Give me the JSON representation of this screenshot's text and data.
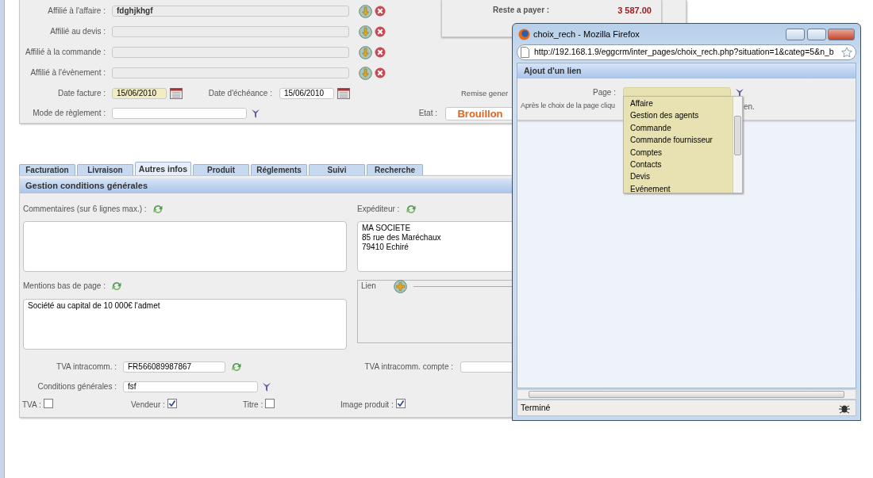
{
  "summary": {
    "label": "Reste a payer :",
    "value": "3 587.00"
  },
  "affiliations": [
    {
      "label": "Affilié à l'affaire :",
      "value": "fdghjkhgf"
    },
    {
      "label": "Affilié au devis :"
    },
    {
      "label": "Affilié à la commande :"
    },
    {
      "label": "Affilié à l'évènement :"
    }
  ],
  "dates": {
    "invoice_label": "Date facture :",
    "invoice_value": "15/06/2010",
    "due_label": "Date d'échéance :",
    "due_value": "15/06/2010",
    "discount_label": "Remise gener"
  },
  "payment": {
    "label": "Mode de règlement :",
    "status_label": "Etat :",
    "status_value": "Brouillon"
  },
  "tabs": [
    {
      "label": "Facturation",
      "selected": false
    },
    {
      "label": "Livraison",
      "selected": false
    },
    {
      "label": "Autres infos",
      "selected": true
    },
    {
      "label": "Produit",
      "selected": false
    },
    {
      "label": "Réglements",
      "selected": false
    },
    {
      "label": "Suivi",
      "selected": false
    },
    {
      "label": "Recherche",
      "selected": false
    }
  ],
  "panel": {
    "title": "Gestion conditions générales",
    "comments_label": "Commentaires (sur 6 lignes max.) :",
    "sender_label": "Expéditeur :",
    "sender_value": "MA SOCIETE\n85 rue des Maréchaux\n79410 Echiré",
    "footer_label": "Mentions bas de page :",
    "footer_value": "Société au capital de 10 000€ l'admet",
    "link_label": "Lien",
    "vat_label": "TVA intracomm. :",
    "vat_value": "FR566089987867",
    "vat_account_label": "TVA intracomm. compte :",
    "terms_label": "Conditions générales :",
    "terms_value": "fsf",
    "checkboxes": [
      {
        "label": "TVA :",
        "checked": false
      },
      {
        "label": "Vendeur :",
        "checked": true
      },
      {
        "label": "Titre :",
        "checked": false
      },
      {
        "label": "Image produit :",
        "checked": true
      }
    ]
  },
  "popup": {
    "title": "choix_rech - Mozilla Firefox",
    "url": "http://192.168.1.9/eggcrm/inter_pages/choix_rech.php?situation=1&categ=5&n_b",
    "header": "Ajout d'un lien",
    "page_label": "Page :",
    "hint_start": "Après le choix de la page cliqu",
    "hint_end": "en.",
    "options": [
      "Affaire",
      "Gestion des agents",
      "Commande",
      "Commande fournisseur",
      "Comptes",
      "Contacts",
      "Devis",
      "Evénement"
    ],
    "status": "Terminé"
  }
}
